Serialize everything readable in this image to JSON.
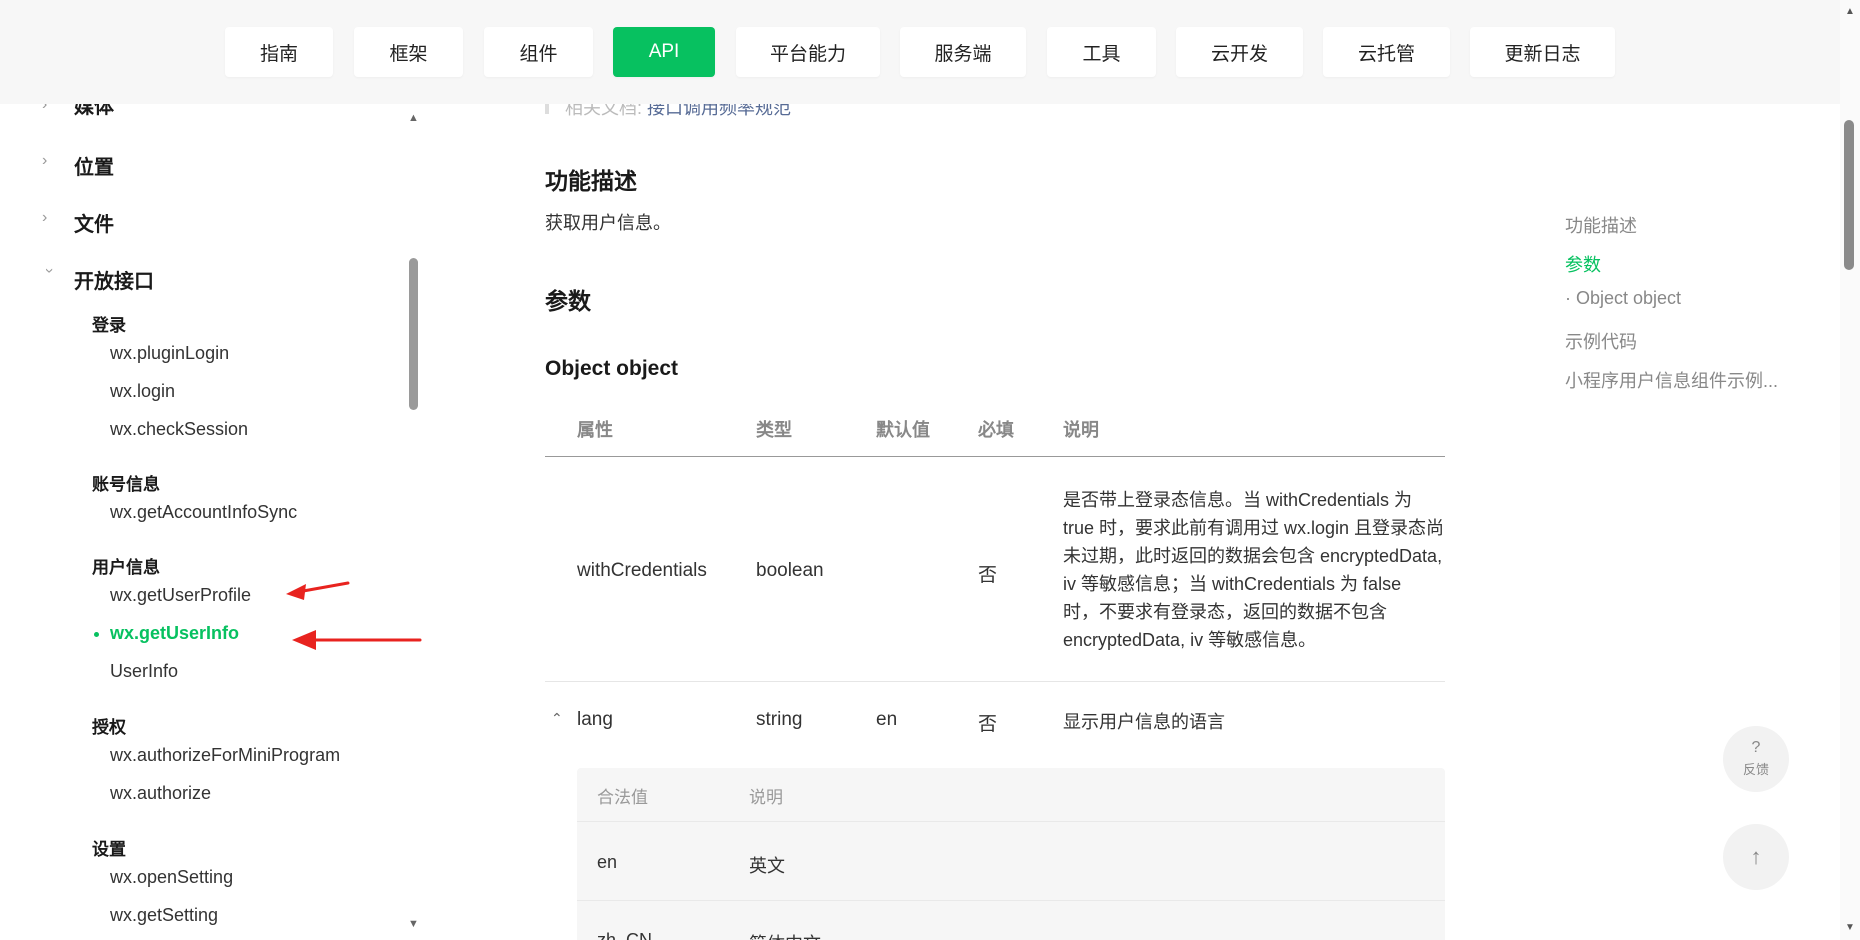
{
  "nav": {
    "tabs": [
      {
        "label": "指南"
      },
      {
        "label": "框架"
      },
      {
        "label": "组件"
      },
      {
        "label": "API",
        "active": true
      },
      {
        "label": "平台能力"
      },
      {
        "label": "服务端"
      },
      {
        "label": "工具"
      },
      {
        "label": "云开发"
      },
      {
        "label": "云托管"
      },
      {
        "label": "更新日志"
      }
    ]
  },
  "sidebar": {
    "categories": [
      {
        "label": "媒体"
      },
      {
        "label": "位置"
      },
      {
        "label": "文件"
      },
      {
        "label": "开放接口",
        "expanded": true
      }
    ],
    "groups": [
      {
        "title": "登录",
        "items": [
          "wx.pluginLogin",
          "wx.login",
          "wx.checkSession"
        ]
      },
      {
        "title": "账号信息",
        "items": [
          "wx.getAccountInfoSync"
        ]
      },
      {
        "title": "用户信息",
        "items": [
          "wx.getUserProfile",
          "wx.getUserInfo",
          "UserInfo"
        ],
        "active_item": "wx.getUserInfo"
      },
      {
        "title": "授权",
        "items": [
          "wx.authorizeForMiniProgram",
          "wx.authorize"
        ]
      },
      {
        "title": "设置",
        "items": [
          "wx.openSetting",
          "wx.getSetting"
        ]
      }
    ]
  },
  "main": {
    "related_prefix": "相关文档: ",
    "related_link": "接口调用频率规范",
    "section_desc_title": "功能描述",
    "section_desc_text": "获取用户信息。",
    "section_params_title": "参数",
    "object_title": "Object object",
    "table": {
      "headers": [
        "属性",
        "类型",
        "默认值",
        "必填",
        "说明"
      ],
      "rows": [
        {
          "name": "withCredentials",
          "type": "boolean",
          "default": "",
          "required": "否",
          "desc_lines": [
            "是否带上登录态信息。当 withCredentials 为",
            "true 时，要求此前有调用过 wx.login 且登录态尚",
            "未过期，此时返回的数据会包含 encryptedData,",
            "iv 等敏感信息；当 withCredentials 为 false",
            "时，不要求有登录态，返回的数据不包含",
            "encryptedData, iv 等敏感信息。"
          ]
        },
        {
          "name": "lang",
          "type": "string",
          "default": "en",
          "required": "否",
          "desc_lines": [
            "显示用户信息的语言"
          ],
          "expanded": true
        }
      ],
      "subtable": {
        "headers": [
          "合法值",
          "说明"
        ],
        "rows": [
          {
            "value": "en",
            "desc": "英文"
          },
          {
            "value": "zh_CN",
            "desc": "简体中文"
          }
        ]
      }
    }
  },
  "toc": {
    "items": [
      {
        "label": "功能描述"
      },
      {
        "label": "参数",
        "active": true
      },
      {
        "label": "· Object object"
      },
      {
        "label": "示例代码"
      },
      {
        "label": "小程序用户信息组件示例..."
      }
    ]
  },
  "float_buttons": {
    "feedback_symbol": "?",
    "feedback_label": "反馈",
    "top_symbol": "↑"
  },
  "colors": {
    "accent": "#07c160",
    "annotation": "#e8231f",
    "link": "#576b95"
  }
}
